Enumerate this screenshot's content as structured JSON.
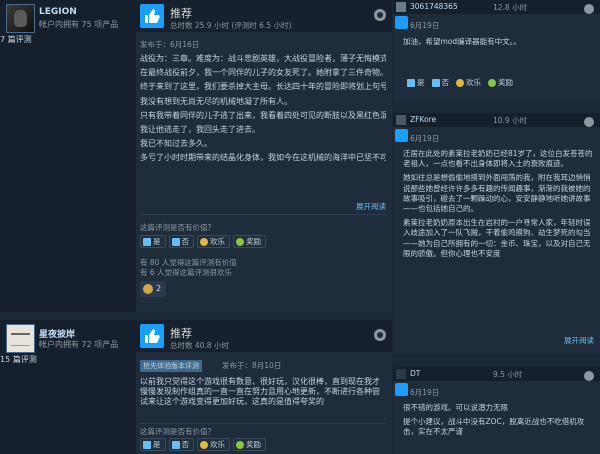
{
  "colors": {
    "accent": "#1a9fff",
    "link": "#66c0f4",
    "bg": "#1b2838"
  },
  "reviews": [
    {
      "author": {
        "name": "LEGION",
        "stat": "帐户内拥有 75 项产品",
        "reviews": "7 篇评测"
      },
      "recommendation": "推荐",
      "hours": "总时数 25.9 小时 (评测时 6.5 小时)",
      "posted": "发布于：6月16日",
      "paragraphs": [
        "战役为：三章。难度为：战斗悲剧英雄，大战役冒险者，薄子无悔模式",
        "在最终战役前夕，我一个同伴的儿子的女友死了。她附拿了三件奇物。",
        "终于来到了这里，我们要杀掉大主母。长达四十年的冒险即将划上句号。",
        "我没有想到无尚无尽的机械地凝了所有人。",
        "只有我带着同伴的儿子逃了出来，我看着四处可见的断肢以及黑红色混合液体。",
        "我让他逃走了，我回头走了进去。",
        "我已不知过去多久。",
        "多亏了小时时期带来的结晶化身体，我如今在这机械的海洋中已坚不可摧，只靠身体本能便能格挡，闪避所有的危险性行为。"
      ],
      "expand": "展开阅读",
      "helpful_q": "这篇评测是否有价值？",
      "buttons": [
        "是",
        "否",
        "欢乐",
        "奖励"
      ],
      "stats": [
        "有 80 人觉得这篇评测有价值",
        "有 6 人觉得这篇评测很欢乐"
      ],
      "award_count": "2"
    },
    {
      "author": {
        "name": "星夜披岸",
        "stat": "帐户内拥有 72 项产品",
        "reviews": "15 篇评测"
      },
      "recommendation": "推荐",
      "hours": "总时数 40.8 小时",
      "badge": "抢先体验版本评测",
      "posted": "发布于：8月10日",
      "paragraphs": [
        "以前我只觉得这个游戏很有数意、很好玩，汉化很棒，直到现在我才慢慢发现制作组真的一直一直在努力且用心地更新，不断进行各种尝试来让这个游戏变得更加好玩，这真的是值得夸奖的"
      ],
      "helpful_q": "这篇评测是否有价值？",
      "buttons": [
        "是",
        "否",
        "欢乐",
        "奖励"
      ]
    }
  ],
  "replies": [
    {
      "name": "3061748365",
      "hours": "12.8 小时",
      "posted": "6月19日",
      "paragraphs": [
        "加油，希望mod编译器能有中文。。"
      ],
      "buttons": [
        "是",
        "否",
        "欢乐",
        "奖励"
      ]
    },
    {
      "name": "ZFKore",
      "hours": "10.9 小时",
      "posted": "6月19日",
      "paragraphs": [
        "迁居在此处的素莱拉老奶奶已经81岁了，这位白发苍苍的老祖人，一点也看不出身体即将入土的衰败痕迹。",
        "她如往总是想偷偷地摸到外面闯荡的我，附在我耳边悄悄说那些她曾经许许多多有趣的传闻趣事，渐渐的我被她的故事吸引，碰去了一颗躁动的心，安安静静地听她讲故事——也包括她自己的。",
        "素莱拉老奶奶原本出生在岩村的一户寻常人家，年轻时误入歧途加入了一队飞贼，干着偷鸡摸狗、劫生梦死的勾当——她为自己所拥有的一切：金币、珠宝，以及对自己无限的骄傲。但你心理也不安度"
      ],
      "expand": "展开阅读"
    },
    {
      "name": "DT",
      "hours": "9.5 小时",
      "posted": "6月19日",
      "paragraphs": [
        "很不错的游戏。可以说潜力无限",
        "提个小建议，战斗中没有ZOC，脱离近战也不吃借机攻击，实在不太严谨"
      ]
    }
  ]
}
